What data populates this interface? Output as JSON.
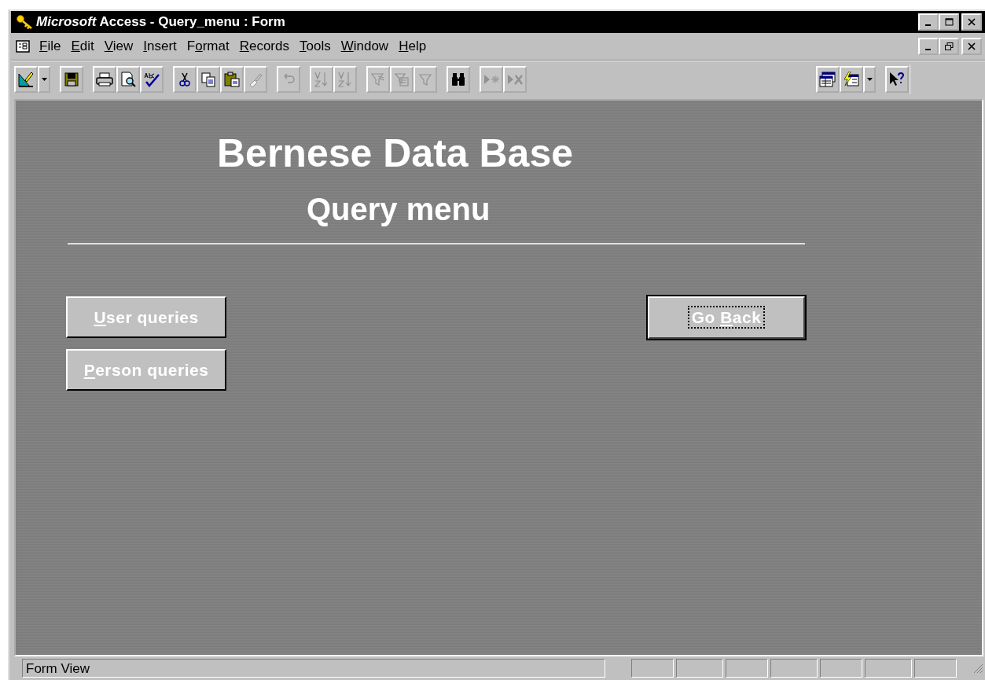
{
  "window": {
    "title": "*Microsoft* Access - Query_menu : Form"
  },
  "menu": [
    {
      "key": "F",
      "post": "ile"
    },
    {
      "key": "E",
      "post": "dit"
    },
    {
      "key": "V",
      "post": "iew"
    },
    {
      "key": "I",
      "post": "nsert"
    },
    {
      "pre": "F",
      "key": "o",
      "post": "rmat"
    },
    {
      "key": "R",
      "post": "ecords"
    },
    {
      "key": "T",
      "post": "ools"
    },
    {
      "key": "W",
      "post": "indow"
    },
    {
      "key": "H",
      "post": "elp"
    }
  ],
  "toolbar": [
    [
      {
        "kind": "design",
        "disabled": false,
        "dropdown": true
      }
    ],
    [
      {
        "kind": "save",
        "disabled": false,
        "dropdown": false
      }
    ],
    [
      {
        "kind": "print",
        "disabled": false,
        "dropdown": false
      },
      {
        "kind": "preview",
        "disabled": false,
        "dropdown": false
      },
      {
        "kind": "spelling",
        "disabled": false,
        "dropdown": false
      }
    ],
    [
      {
        "kind": "cut",
        "disabled": false,
        "dropdown": false
      },
      {
        "kind": "copy",
        "disabled": false,
        "dropdown": false
      },
      {
        "kind": "paste",
        "disabled": false,
        "dropdown": false
      },
      {
        "kind": "brush",
        "disabled": true,
        "dropdown": false
      }
    ],
    [
      {
        "kind": "undo",
        "disabled": true,
        "dropdown": false
      }
    ],
    [
      {
        "kind": "sort-asc",
        "disabled": true,
        "dropdown": false
      },
      {
        "kind": "sort-desc",
        "disabled": true,
        "dropdown": false
      }
    ],
    [
      {
        "kind": "filter-selection",
        "disabled": true,
        "dropdown": false
      },
      {
        "kind": "filter-form",
        "disabled": true,
        "dropdown": false
      },
      {
        "kind": "filter",
        "disabled": true,
        "dropdown": false
      }
    ],
    [
      {
        "kind": "find",
        "disabled": false,
        "dropdown": false
      }
    ],
    [
      {
        "kind": "new-record",
        "disabled": true,
        "dropdown": false
      },
      {
        "kind": "delete-record",
        "disabled": true,
        "dropdown": false
      }
    ]
  ],
  "toolbar_right": [
    [
      {
        "kind": "database-window",
        "disabled": false,
        "dropdown": false
      },
      {
        "kind": "new-object",
        "disabled": false,
        "dropdown": true
      }
    ],
    [
      {
        "kind": "help",
        "disabled": false,
        "dropdown": false
      }
    ]
  ],
  "form": {
    "title": "Bernese Data Base",
    "subtitle": "Query menu",
    "left_buttons": [
      {
        "key": "U",
        "post": "ser queries",
        "focused": false
      },
      {
        "key": "P",
        "post": "erson queries",
        "focused": false
      }
    ],
    "right_buttons": [
      {
        "pre": "Go ",
        "key": "B",
        "post": "ack",
        "focused": true
      }
    ]
  },
  "status_bar": {
    "text": "Form View"
  }
}
